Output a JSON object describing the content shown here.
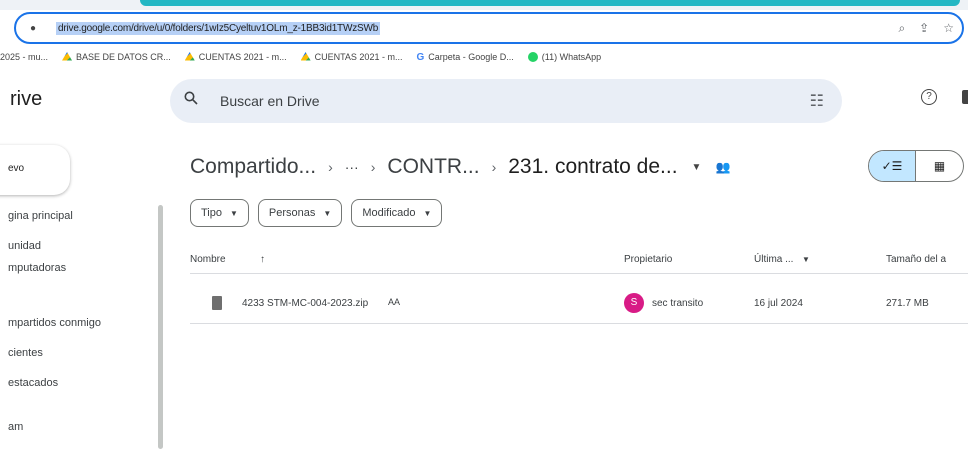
{
  "browser": {
    "url": "drive.google.com/drive/u/0/folders/1wIz5Cyeltuv1OLm_z-1BB3id1TWzSWb",
    "bookmarks": [
      {
        "label": "2025 - mu...",
        "icon": "none"
      },
      {
        "label": "BASE DE DATOS CR...",
        "icon": "drive-icon"
      },
      {
        "label": "CUENTAS 2021 - m...",
        "icon": "drive-icon"
      },
      {
        "label": "CUENTAS 2021 - m...",
        "icon": "drive-icon"
      },
      {
        "label": "Carpeta - Google D...",
        "icon": "google-icon"
      },
      {
        "label": "(11) WhatsApp",
        "icon": "whatsapp-icon"
      }
    ]
  },
  "app": {
    "title": "rive",
    "search_placeholder": "Buscar en Drive",
    "new_button": "evo"
  },
  "sidebar": {
    "items": [
      {
        "label": "gina principal"
      },
      {
        "label": "unidad"
      },
      {
        "label": "mputadoras"
      },
      {
        "label": "mpartidos conmigo"
      },
      {
        "label": "cientes"
      },
      {
        "label": "estacados"
      },
      {
        "label": "am"
      }
    ]
  },
  "breadcrumb": {
    "items": [
      "Compartido...",
      "···",
      "CONTR...",
      "231. contrato de..."
    ],
    "separator": "›"
  },
  "filters": [
    "Tipo",
    "Personas",
    "Modificado"
  ],
  "table": {
    "headers": {
      "name": "Nombre",
      "sort_arrow": "↑",
      "owner": "Propietario",
      "modified": "Última ...",
      "size": "Tamaño del a"
    },
    "rows": [
      {
        "name": "4233 STM-MC-004-2023.zip",
        "shared_marker": "AA",
        "owner_initial": "S",
        "owner": "sec transito",
        "modified": "16 jul 2024",
        "size": "271.7 MB"
      }
    ]
  },
  "colors": {
    "accent": "#1a73e8",
    "view_toggle_active": "#c2e7ff",
    "avatar": "#d81b86",
    "search_bg": "#e9eef6"
  }
}
